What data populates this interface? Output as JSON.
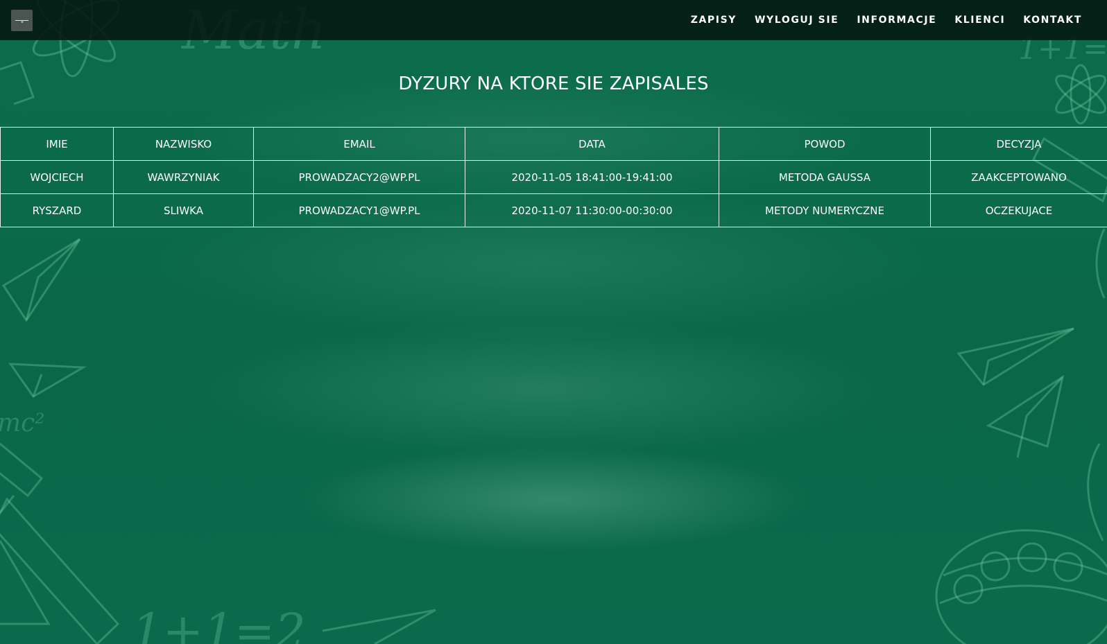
{
  "navbar": {
    "menu_icon": "hamburger-menu-icon",
    "links": [
      "ZAPISY",
      "WYLOGUJ SIE",
      "INFORMACJE",
      "KLIENCI",
      "KONTAKT"
    ]
  },
  "page": {
    "title": "DYZURY NA KTORE SIE ZAPISALES"
  },
  "table": {
    "headers": [
      "IMIE",
      "NAZWISKO",
      "EMAIL",
      "DATA",
      "POWOD",
      "DECYZJA"
    ],
    "rows": [
      [
        "WOJCIECH",
        "WAWRZYNIAK",
        "PROWADZACY2@WP.PL",
        "2020-11-05 18:41:00-19:41:00",
        "METODA GAUSSA",
        "ZAAKCEPTOWANO"
      ],
      [
        "RYSZARD",
        "SLIWKA",
        "PROWADZACY1@WP.PL",
        "2020-11-07 11:30:00-00:30:00",
        "METODY NUMERYCZNE",
        "OCZEKUJACE"
      ]
    ]
  },
  "background": {
    "doodle_texts": [
      "Math",
      "1+1=",
      "mc²",
      "1+1=2"
    ]
  },
  "colors": {
    "background": "#0a6a4a",
    "navbar": "#04160f",
    "text": "#ffffff"
  }
}
